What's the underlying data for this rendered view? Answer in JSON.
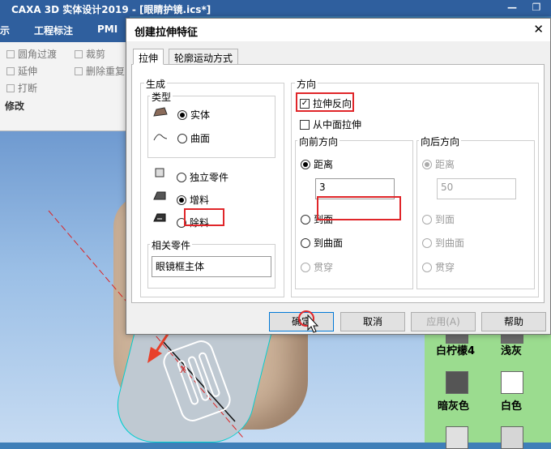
{
  "app": {
    "title": "CAXA 3D 实体设计2019 - [眼睛护镜.ics*]",
    "win_minimize": "—",
    "win_restore": "❐",
    "menu": [
      "示",
      "工程标注",
      "PMI"
    ]
  },
  "ribbon": {
    "fillet_transition": "圆角过渡",
    "extend": "延伸",
    "break": "打断",
    "trim": "裁剪",
    "delete_duplicate": "删除重复",
    "group_label": "修改"
  },
  "palette": {
    "row1": [
      "白柠檬4",
      "浅灰"
    ],
    "row2": [
      "暗灰色",
      "白色"
    ],
    "colors": {
      "dark_gray": "#555555",
      "white": "#ffffff",
      "lemon_white": "#f4f4ec",
      "light_gray": "#d9d9d9"
    }
  },
  "dialog": {
    "title": "创建拉伸特征",
    "close_icon": "✕",
    "tabs": [
      "拉伸",
      "轮廓运动方式"
    ],
    "generate": {
      "label": "生成",
      "type_label": "类型",
      "solid": "实体",
      "surface": "曲面",
      "independent_part": "独立零件",
      "add_material": "增料",
      "remove_material": "除料",
      "related_part_label": "相关零件",
      "related_part_value": "眼镜框主体"
    },
    "direction": {
      "label": "方向",
      "reverse_extrude": "拉伸反向",
      "reverse_checked": true,
      "from_middle": "从中面拉伸",
      "from_middle_checked": false,
      "forward": {
        "label": "向前方向",
        "distance": "距离",
        "distance_value": "3",
        "to_face": "到面",
        "to_surface": "到曲面",
        "through": "贯穿"
      },
      "backward": {
        "label": "向后方向",
        "distance": "距离",
        "distance_value": "50",
        "to_face": "到面",
        "to_surface": "到曲面",
        "through": "贯穿"
      }
    },
    "buttons": {
      "ok": "确定",
      "cancel": "取消",
      "apply": "应用(A)",
      "help": "帮助"
    }
  },
  "accent": {
    "highlight": "#e0262a",
    "arrow": "#e8402a"
  }
}
